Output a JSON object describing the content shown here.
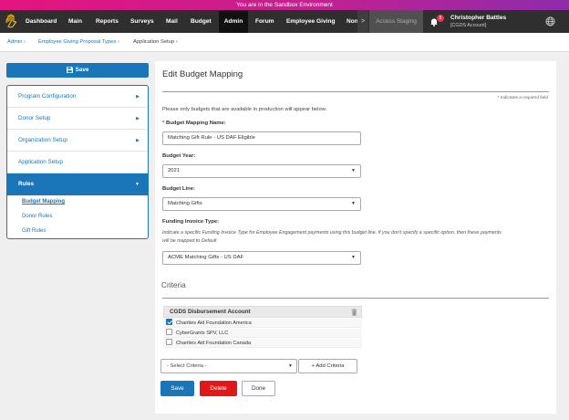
{
  "banner": {
    "text": "You are in the Sandbox Environment"
  },
  "nav": {
    "items": [
      {
        "label": "Dashboard"
      },
      {
        "label": "Main"
      },
      {
        "label": "Reports"
      },
      {
        "label": "Surveys"
      },
      {
        "label": "Mail"
      },
      {
        "label": "Budget"
      },
      {
        "label": "Admin",
        "active": true
      },
      {
        "label": "Forum"
      },
      {
        "label": "Employee Giving"
      },
      {
        "label": "Non"
      }
    ],
    "more": ">",
    "access_staging": "Access Staging",
    "notifications_count": "5",
    "user_name": "Christopher Battles",
    "user_account": "[CGDS Account]"
  },
  "breadcrumb": {
    "items": [
      {
        "label": "Admin ›"
      },
      {
        "label": "Employee Giving Proposal Types ›"
      },
      {
        "label": "Application Setup ›"
      }
    ]
  },
  "sidebar": {
    "save_label": "Save",
    "menu": [
      {
        "label": "Program Configuration",
        "arrow": "▶"
      },
      {
        "label": "Donor Setup",
        "arrow": "▶"
      },
      {
        "label": "Organization Setup",
        "arrow": "▶"
      },
      {
        "label": "Application Setup",
        "arrow": ""
      },
      {
        "label": "Rules",
        "arrow": "▼"
      }
    ],
    "submenu": [
      {
        "label": "Budget Mapping"
      },
      {
        "label": "Donor Rules"
      },
      {
        "label": "Gift Rules"
      }
    ]
  },
  "form": {
    "title": "Edit Budget Mapping",
    "required_note": "* Indicates a required field",
    "intro": "Please only budgets that are available in production will appear below.",
    "required_star": "*",
    "name_label": "Budget Mapping Name:",
    "name_value": "Matching Gift Rule - US DAF Eligible",
    "year_label": "Budget Year:",
    "year_value": "2021",
    "line_label": "Budget Line:",
    "line_value": "Matching Gifts",
    "invoice_label": "Funding Invoice Type:",
    "invoice_help": "Indicate a specific Funding Invoice Type for Employee Engagement payments using this budget line. If you don't specify a specific option, then these payments will be mapped to Default",
    "invoice_value": "ACME Matching Gifts - US DAF",
    "criteria_label": "Criteria",
    "cgds": {
      "header": "CGDS Disbursement Account",
      "options": [
        {
          "label": "Charities Aid Foundation America",
          "checked": true
        },
        {
          "label": "CyberGrants SPV, LLC",
          "checked": false
        },
        {
          "label": "Charities Aid Foundation Canada",
          "checked": false
        }
      ]
    },
    "select_criteria": "- Select Criteria -",
    "add_criteria": "+ Add Criteria",
    "save": "Save",
    "delete": "Delete",
    "done": "Done"
  },
  "colors": {
    "primary": "#1a76b8",
    "danger": "#e01818",
    "nav_bg": "#2f2f2f"
  }
}
